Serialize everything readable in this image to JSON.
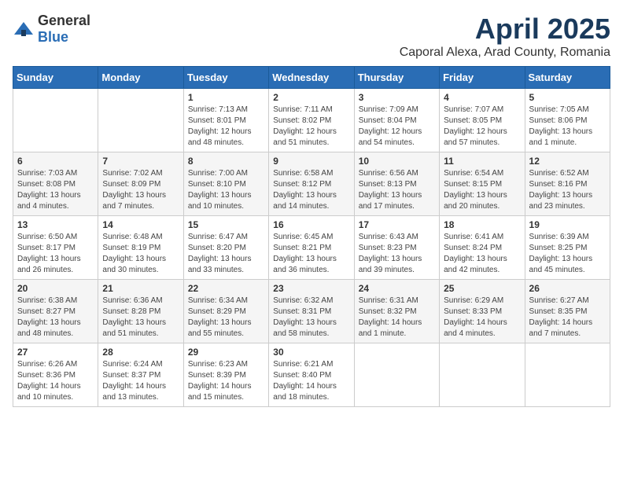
{
  "header": {
    "logo_general": "General",
    "logo_blue": "Blue",
    "title": "April 2025",
    "subtitle": "Caporal Alexa, Arad County, Romania"
  },
  "days_of_week": [
    "Sunday",
    "Monday",
    "Tuesday",
    "Wednesday",
    "Thursday",
    "Friday",
    "Saturday"
  ],
  "weeks": [
    [
      {
        "day": "",
        "info": ""
      },
      {
        "day": "",
        "info": ""
      },
      {
        "day": "1",
        "info": "Sunrise: 7:13 AM\nSunset: 8:01 PM\nDaylight: 12 hours and 48 minutes."
      },
      {
        "day": "2",
        "info": "Sunrise: 7:11 AM\nSunset: 8:02 PM\nDaylight: 12 hours and 51 minutes."
      },
      {
        "day": "3",
        "info": "Sunrise: 7:09 AM\nSunset: 8:04 PM\nDaylight: 12 hours and 54 minutes."
      },
      {
        "day": "4",
        "info": "Sunrise: 7:07 AM\nSunset: 8:05 PM\nDaylight: 12 hours and 57 minutes."
      },
      {
        "day": "5",
        "info": "Sunrise: 7:05 AM\nSunset: 8:06 PM\nDaylight: 13 hours and 1 minute."
      }
    ],
    [
      {
        "day": "6",
        "info": "Sunrise: 7:03 AM\nSunset: 8:08 PM\nDaylight: 13 hours and 4 minutes."
      },
      {
        "day": "7",
        "info": "Sunrise: 7:02 AM\nSunset: 8:09 PM\nDaylight: 13 hours and 7 minutes."
      },
      {
        "day": "8",
        "info": "Sunrise: 7:00 AM\nSunset: 8:10 PM\nDaylight: 13 hours and 10 minutes."
      },
      {
        "day": "9",
        "info": "Sunrise: 6:58 AM\nSunset: 8:12 PM\nDaylight: 13 hours and 14 minutes."
      },
      {
        "day": "10",
        "info": "Sunrise: 6:56 AM\nSunset: 8:13 PM\nDaylight: 13 hours and 17 minutes."
      },
      {
        "day": "11",
        "info": "Sunrise: 6:54 AM\nSunset: 8:15 PM\nDaylight: 13 hours and 20 minutes."
      },
      {
        "day": "12",
        "info": "Sunrise: 6:52 AM\nSunset: 8:16 PM\nDaylight: 13 hours and 23 minutes."
      }
    ],
    [
      {
        "day": "13",
        "info": "Sunrise: 6:50 AM\nSunset: 8:17 PM\nDaylight: 13 hours and 26 minutes."
      },
      {
        "day": "14",
        "info": "Sunrise: 6:48 AM\nSunset: 8:19 PM\nDaylight: 13 hours and 30 minutes."
      },
      {
        "day": "15",
        "info": "Sunrise: 6:47 AM\nSunset: 8:20 PM\nDaylight: 13 hours and 33 minutes."
      },
      {
        "day": "16",
        "info": "Sunrise: 6:45 AM\nSunset: 8:21 PM\nDaylight: 13 hours and 36 minutes."
      },
      {
        "day": "17",
        "info": "Sunrise: 6:43 AM\nSunset: 8:23 PM\nDaylight: 13 hours and 39 minutes."
      },
      {
        "day": "18",
        "info": "Sunrise: 6:41 AM\nSunset: 8:24 PM\nDaylight: 13 hours and 42 minutes."
      },
      {
        "day": "19",
        "info": "Sunrise: 6:39 AM\nSunset: 8:25 PM\nDaylight: 13 hours and 45 minutes."
      }
    ],
    [
      {
        "day": "20",
        "info": "Sunrise: 6:38 AM\nSunset: 8:27 PM\nDaylight: 13 hours and 48 minutes."
      },
      {
        "day": "21",
        "info": "Sunrise: 6:36 AM\nSunset: 8:28 PM\nDaylight: 13 hours and 51 minutes."
      },
      {
        "day": "22",
        "info": "Sunrise: 6:34 AM\nSunset: 8:29 PM\nDaylight: 13 hours and 55 minutes."
      },
      {
        "day": "23",
        "info": "Sunrise: 6:32 AM\nSunset: 8:31 PM\nDaylight: 13 hours and 58 minutes."
      },
      {
        "day": "24",
        "info": "Sunrise: 6:31 AM\nSunset: 8:32 PM\nDaylight: 14 hours and 1 minute."
      },
      {
        "day": "25",
        "info": "Sunrise: 6:29 AM\nSunset: 8:33 PM\nDaylight: 14 hours and 4 minutes."
      },
      {
        "day": "26",
        "info": "Sunrise: 6:27 AM\nSunset: 8:35 PM\nDaylight: 14 hours and 7 minutes."
      }
    ],
    [
      {
        "day": "27",
        "info": "Sunrise: 6:26 AM\nSunset: 8:36 PM\nDaylight: 14 hours and 10 minutes."
      },
      {
        "day": "28",
        "info": "Sunrise: 6:24 AM\nSunset: 8:37 PM\nDaylight: 14 hours and 13 minutes."
      },
      {
        "day": "29",
        "info": "Sunrise: 6:23 AM\nSunset: 8:39 PM\nDaylight: 14 hours and 15 minutes."
      },
      {
        "day": "30",
        "info": "Sunrise: 6:21 AM\nSunset: 8:40 PM\nDaylight: 14 hours and 18 minutes."
      },
      {
        "day": "",
        "info": ""
      },
      {
        "day": "",
        "info": ""
      },
      {
        "day": "",
        "info": ""
      }
    ]
  ]
}
